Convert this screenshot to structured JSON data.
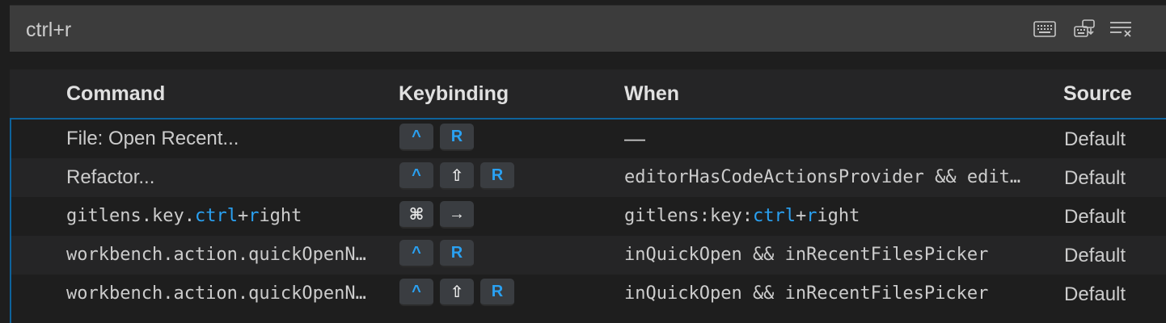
{
  "search": {
    "value": "ctrl+r",
    "actions": [
      {
        "icon": "keyboard-icon"
      },
      {
        "icon": "record-keys-icon"
      },
      {
        "icon": "clear-filter-icon"
      }
    ]
  },
  "columns": {
    "command": "Command",
    "keybinding": "Keybinding",
    "when": "When",
    "source": "Source"
  },
  "rows": [
    {
      "command": {
        "pre": "File: Open Recent...",
        "hl": "",
        "mid": "",
        "hl2": "",
        "post": ""
      },
      "command_mono": false,
      "keys": [
        {
          "label": "^",
          "style": "blue"
        },
        {
          "label": "R",
          "style": "blue"
        }
      ],
      "when": {
        "pre": "—",
        "hl": "",
        "mid": "",
        "hl2": "",
        "post": ""
      },
      "when_mono": false,
      "source": "Default"
    },
    {
      "command": {
        "pre": "Refactor...",
        "hl": "",
        "mid": "",
        "hl2": "",
        "post": ""
      },
      "command_mono": false,
      "keys": [
        {
          "label": "^",
          "style": "blue"
        },
        {
          "label": "⇧",
          "style": "white"
        },
        {
          "label": "R",
          "style": "blue"
        }
      ],
      "when": {
        "pre": "editorHasCodeActionsProvider && edit…",
        "hl": "",
        "mid": "",
        "hl2": "",
        "post": ""
      },
      "when_mono": true,
      "source": "Default"
    },
    {
      "command": {
        "pre": "gitlens.key.",
        "hl": "ctrl",
        "mid": "+",
        "hl2": "r",
        "post": "ight"
      },
      "command_mono": true,
      "keys": [
        {
          "label": "⌘",
          "style": "white"
        },
        {
          "label": "→",
          "style": "white"
        }
      ],
      "when": {
        "pre": "gitlens:key:",
        "hl": "ctrl",
        "mid": "+",
        "hl2": "r",
        "post": "ight"
      },
      "when_mono": true,
      "source": "Default"
    },
    {
      "command": {
        "pre": "workbench.action.quickOpenN…",
        "hl": "",
        "mid": "",
        "hl2": "",
        "post": ""
      },
      "command_mono": true,
      "keys": [
        {
          "label": "^",
          "style": "blue"
        },
        {
          "label": "R",
          "style": "blue"
        }
      ],
      "when": {
        "pre": "inQuickOpen && inRecentFilesPicker",
        "hl": "",
        "mid": "",
        "hl2": "",
        "post": ""
      },
      "when_mono": true,
      "source": "Default"
    },
    {
      "command": {
        "pre": "workbench.action.quickOpenN…",
        "hl": "",
        "mid": "",
        "hl2": "",
        "post": ""
      },
      "command_mono": true,
      "keys": [
        {
          "label": "^",
          "style": "blue"
        },
        {
          "label": "⇧",
          "style": "white"
        },
        {
          "label": "R",
          "style": "blue"
        }
      ],
      "when": {
        "pre": "inQuickOpen && inRecentFilesPicker",
        "hl": "",
        "mid": "",
        "hl2": "",
        "post": ""
      },
      "when_mono": true,
      "source": "Default"
    }
  ],
  "colors": {
    "background": "#1e1e1e",
    "highlight": "#2aa1f2",
    "focus_border": "#0e639c"
  }
}
